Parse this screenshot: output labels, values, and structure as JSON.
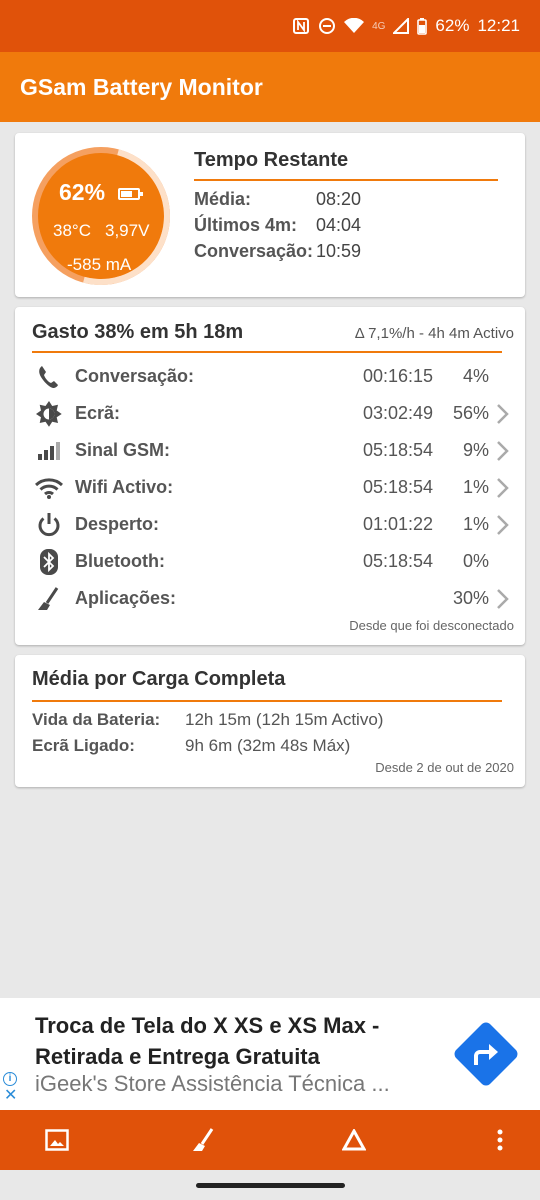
{
  "status_bar": {
    "battery": "62%",
    "time": "12:21",
    "network": "4G",
    "icons": [
      "nfc-icon",
      "do-not-disturb-icon",
      "wifi-icon",
      "signal-icon",
      "battery-icon"
    ]
  },
  "app_bar": {
    "title": "GSam Battery Monitor"
  },
  "summary": {
    "gauge": {
      "percent": "62%",
      "temperature": "38°C",
      "voltage": "3,97V",
      "current": "-585 mA",
      "level": 0.62
    },
    "title": "Tempo Restante",
    "rows": [
      {
        "label": "Média:",
        "value": "08:20"
      },
      {
        "label": "Últimos 4m:",
        "value": "04:04"
      },
      {
        "label": "Conversação:",
        "value": "10:59"
      }
    ]
  },
  "usage": {
    "title": "Gasto 38% em 5h 18m",
    "rate": "Δ 7,1%/h - 4h 4m Activo",
    "items": [
      {
        "icon": "phone-icon",
        "name": "Conversação:",
        "time": "00:16:15",
        "percent": "4%",
        "chevron": false
      },
      {
        "icon": "brightness-icon",
        "name": "Ecrã:",
        "time": "03:02:49",
        "percent": "56%",
        "chevron": true
      },
      {
        "icon": "signal-bars-icon",
        "name": "Sinal GSM:",
        "time": "05:18:54",
        "percent": "9%",
        "chevron": true
      },
      {
        "icon": "wifi-icon",
        "name": "Wifi Activo:",
        "time": "05:18:54",
        "percent": "1%",
        "chevron": true
      },
      {
        "icon": "power-icon",
        "name": "Desperto:",
        "time": "01:01:22",
        "percent": "1%",
        "chevron": true
      },
      {
        "icon": "bluetooth-icon",
        "name": "Bluetooth:",
        "time": "05:18:54",
        "percent": "0%",
        "chevron": false
      },
      {
        "icon": "broom-icon",
        "name": "Aplicações:",
        "time": "",
        "percent": "30%",
        "chevron": true
      }
    ],
    "footer": "Desde que foi desconectado"
  },
  "average": {
    "title": "Média por Carga Completa",
    "rows": [
      {
        "label": "Vida da Bateria:",
        "value": "12h 15m (12h 15m Activo)"
      },
      {
        "label": "Ecrã Ligado:",
        "value": "9h 6m (32m 48s Máx)"
      }
    ],
    "footer": "Desde 2 de out de 2020"
  },
  "ad": {
    "headline": "Troca de Tela do X XS e XS Max - Retirada e Entrega Gratuita",
    "advertiser": "iGeek's Store Assistência Técnica ...",
    "info_glyph": "i",
    "close_glyph": "✕"
  },
  "bottom_bar": {
    "icons": [
      "image-icon",
      "broom-icon",
      "triangle-icon",
      "more-vert-icon"
    ]
  },
  "colors": {
    "status_bar": "#e0520a",
    "app_bar": "#f07a0c",
    "accent": "#f07a0c",
    "ad_icon": "#1a73e8"
  }
}
